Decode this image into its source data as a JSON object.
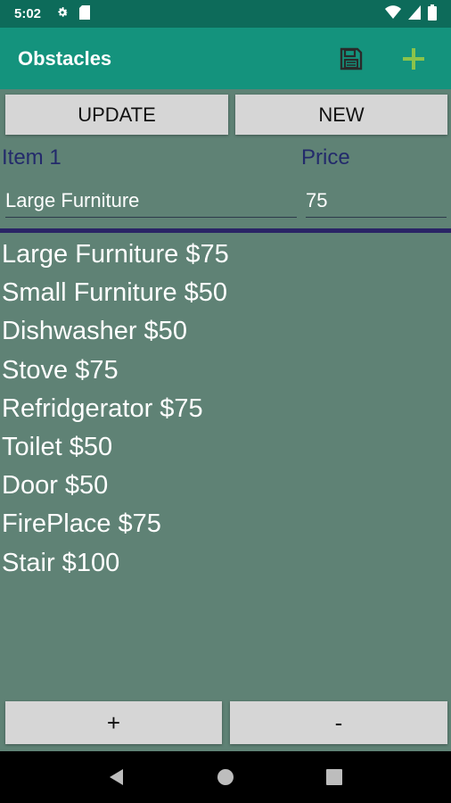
{
  "status_bar": {
    "time": "5:02",
    "icons": [
      "settings-icon",
      "sd-card-icon",
      "wifi-icon",
      "signal-icon",
      "battery-icon"
    ]
  },
  "app_bar": {
    "title": "Obstacles",
    "actions": [
      "save-icon",
      "add-icon"
    ],
    "accent_add": "#8bc34a"
  },
  "buttons": {
    "update_label": "UPDATE",
    "new_label": "NEW",
    "plus_label": "+",
    "minus_label": "-"
  },
  "form": {
    "item_label": "Item 1",
    "price_label": "Price",
    "item_value": "Large Furniture",
    "price_value": "75"
  },
  "list": [
    "Large Furniture $75",
    "Small Furniture $50",
    "Dishwasher $50",
    "Stove $75",
    "Refridgerator $75",
    "Toilet $50",
    "Door $50",
    "FirePlace $75",
    "Stair $100"
  ],
  "nav_bar": {
    "icons": [
      "back-icon",
      "home-icon",
      "recents-icon"
    ]
  },
  "colors": {
    "status_bar": "#0d6b5a",
    "app_bar": "#14937d",
    "background": "#5f8275",
    "label_text": "#232a6b",
    "divider": "#2a2466"
  }
}
